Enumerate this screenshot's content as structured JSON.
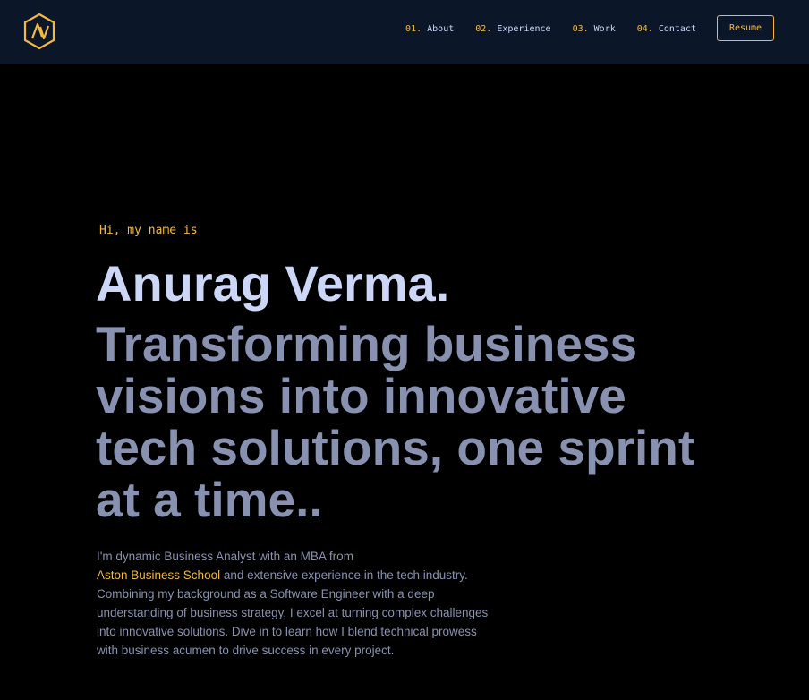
{
  "colors": {
    "accent": "#f5b93d",
    "nav_background": "#0b1628",
    "page_background": "#000000",
    "heading": "#ccd6f6",
    "body_text": "#8892b0"
  },
  "logo": {
    "icon": "hexagon-monogram-icon"
  },
  "nav": {
    "items": [
      {
        "number": "01.",
        "label": "About"
      },
      {
        "number": "02.",
        "label": "Experience"
      },
      {
        "number": "03.",
        "label": "Work"
      },
      {
        "number": "04.",
        "label": "Contact"
      }
    ],
    "resume_label": "Resume"
  },
  "hero": {
    "greeting": "Hi, my name is",
    "name": "Anurag Verma.",
    "tagline": "Transforming business visions into innovative tech solutions, one sprint at a time..",
    "bio_before": "I'm dynamic Business Analyst with an MBA from",
    "bio_link": "Aston Business School",
    "bio_after": "and extensive experience in the tech industry. Combining my background as a Software Engineer with a deep understanding of business strategy, I excel at turning complex challenges into innovative solutions. Dive in to learn how I blend technical prowess with business acumen to drive success in every project."
  }
}
